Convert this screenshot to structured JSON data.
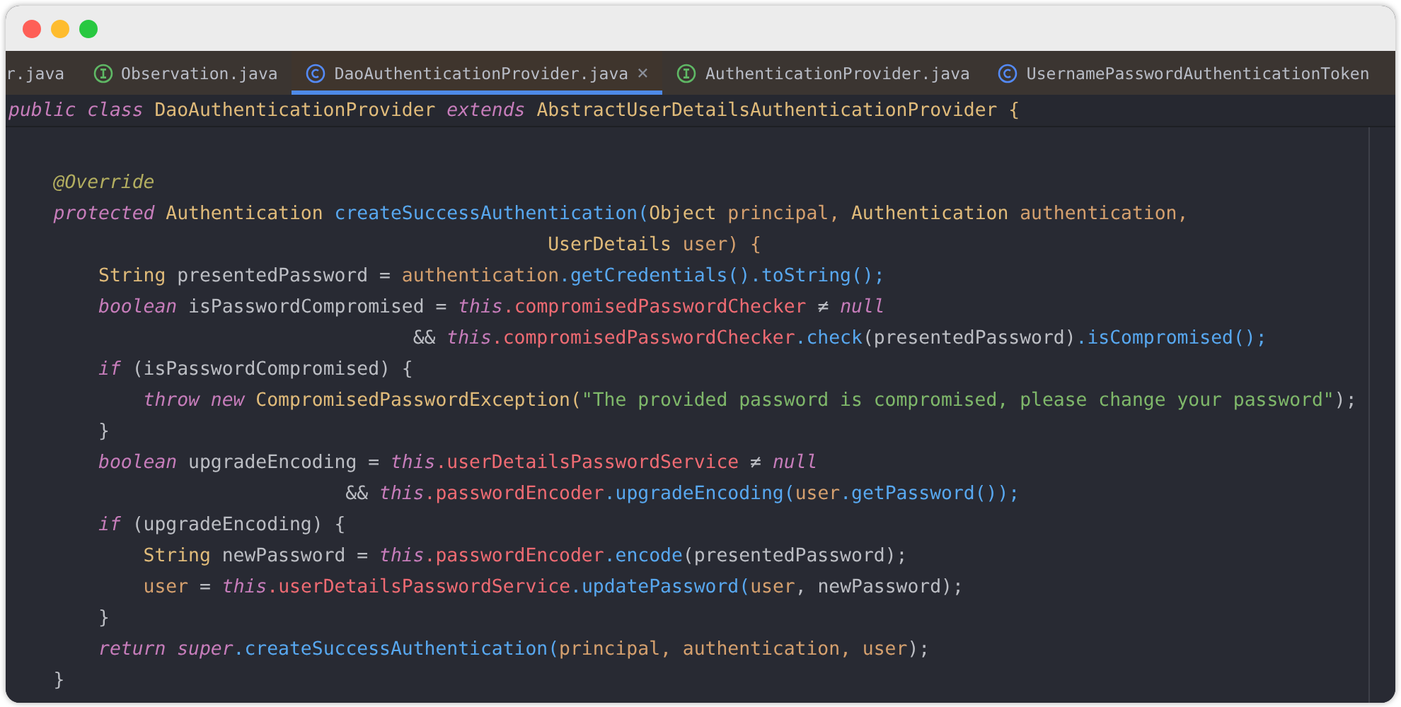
{
  "tabs": [
    {
      "label": "r.java",
      "kind": "file",
      "selected": false
    },
    {
      "label": "Observation.java",
      "kind": "interface",
      "selected": false
    },
    {
      "label": "DaoAuthenticationProvider.java",
      "kind": "class",
      "selected": true,
      "close": "×"
    },
    {
      "label": "AuthenticationProvider.java",
      "kind": "interface",
      "selected": false
    },
    {
      "label": "UsernamePasswordAuthenticationToken",
      "kind": "class",
      "selected": false
    }
  ],
  "sticky_header": [
    {
      "text": "public class ",
      "kind": "keyword"
    },
    {
      "text": "DaoAuthenticationProvider ",
      "kind": "type"
    },
    {
      "text": "extends ",
      "kind": "keyword"
    },
    {
      "text": "AbstractUserDetailsAuthenticationProvider {",
      "kind": "type"
    }
  ],
  "code_lines": [
    [
      {
        "text": "    @Override",
        "kind": "annotation"
      }
    ],
    [
      {
        "text": "    protected ",
        "kind": "keyword"
      },
      {
        "text": "Authentication ",
        "kind": "type"
      },
      {
        "text": "createSuccessAuthentication(",
        "kind": "method"
      },
      {
        "text": "Object ",
        "kind": "type"
      },
      {
        "text": "principal, ",
        "kind": "param"
      },
      {
        "text": "Authentication ",
        "kind": "type"
      },
      {
        "text": "authentication,",
        "kind": "param"
      }
    ],
    [
      {
        "text": "                                                UserDetails ",
        "kind": "type"
      },
      {
        "text": "user) {",
        "kind": "param"
      }
    ],
    [
      {
        "text": "        String ",
        "kind": "type"
      },
      {
        "text": "presentedPassword = ",
        "kind": "plain"
      },
      {
        "text": "authentication",
        "kind": "param"
      },
      {
        "text": ".getCredentials().toString();",
        "kind": "method"
      }
    ],
    [
      {
        "text": "        boolean ",
        "kind": "keyword"
      },
      {
        "text": "isPasswordCompromised = ",
        "kind": "plain"
      },
      {
        "text": "this",
        "kind": "keyword"
      },
      {
        "text": ".compromisedPasswordChecker ",
        "kind": "field"
      },
      {
        "text": "≠ ",
        "kind": "plain"
      },
      {
        "text": "null",
        "kind": "keyword"
      }
    ],
    [
      {
        "text": "                                    && ",
        "kind": "plain"
      },
      {
        "text": "this",
        "kind": "keyword"
      },
      {
        "text": ".compromisedPasswordChecker",
        "kind": "field"
      },
      {
        "text": ".check",
        "kind": "method"
      },
      {
        "text": "(presentedPassword)",
        "kind": "plain"
      },
      {
        "text": ".isCompromised();",
        "kind": "method"
      }
    ],
    [
      {
        "text": "        if ",
        "kind": "keyword"
      },
      {
        "text": "(isPasswordCompromised) {",
        "kind": "plain"
      }
    ],
    [
      {
        "text": "            throw new ",
        "kind": "keyword"
      },
      {
        "text": "CompromisedPasswordException(",
        "kind": "type"
      },
      {
        "text": "\"The provided password is compromised, please change your password\"",
        "kind": "string"
      },
      {
        "text": ");",
        "kind": "plain"
      }
    ],
    [
      {
        "text": "        }",
        "kind": "plain"
      }
    ],
    [
      {
        "text": "        boolean ",
        "kind": "keyword"
      },
      {
        "text": "upgradeEncoding = ",
        "kind": "plain"
      },
      {
        "text": "this",
        "kind": "keyword"
      },
      {
        "text": ".userDetailsPasswordService ",
        "kind": "field"
      },
      {
        "text": "≠ ",
        "kind": "plain"
      },
      {
        "text": "null",
        "kind": "keyword"
      }
    ],
    [
      {
        "text": "                              && ",
        "kind": "plain"
      },
      {
        "text": "this",
        "kind": "keyword"
      },
      {
        "text": ".passwordEncoder",
        "kind": "field"
      },
      {
        "text": ".upgradeEncoding(",
        "kind": "method"
      },
      {
        "text": "user",
        "kind": "param"
      },
      {
        "text": ".getPassword());",
        "kind": "method"
      }
    ],
    [
      {
        "text": "        if ",
        "kind": "keyword"
      },
      {
        "text": "(upgradeEncoding) {",
        "kind": "plain"
      }
    ],
    [
      {
        "text": "            String ",
        "kind": "type"
      },
      {
        "text": "newPassword = ",
        "kind": "plain"
      },
      {
        "text": "this",
        "kind": "keyword"
      },
      {
        "text": ".passwordEncoder",
        "kind": "field"
      },
      {
        "text": ".encode",
        "kind": "method"
      },
      {
        "text": "(presentedPassword);",
        "kind": "plain"
      }
    ],
    [
      {
        "text": "            user ",
        "kind": "param"
      },
      {
        "text": "= ",
        "kind": "plain"
      },
      {
        "text": "this",
        "kind": "keyword"
      },
      {
        "text": ".userDetailsPasswordService",
        "kind": "field"
      },
      {
        "text": ".updatePassword(",
        "kind": "method"
      },
      {
        "text": "user",
        "kind": "param"
      },
      {
        "text": ", newPassword);",
        "kind": "plain"
      }
    ],
    [
      {
        "text": "        }",
        "kind": "plain"
      }
    ],
    [
      {
        "text": "        return super",
        "kind": "keyword"
      },
      {
        "text": ".createSuccessAuthentication(",
        "kind": "method"
      },
      {
        "text": "principal, authentication, user",
        "kind": "param"
      },
      {
        "text": ");",
        "kind": "plain"
      }
    ],
    [
      {
        "text": "    }",
        "kind": "plain"
      }
    ]
  ]
}
